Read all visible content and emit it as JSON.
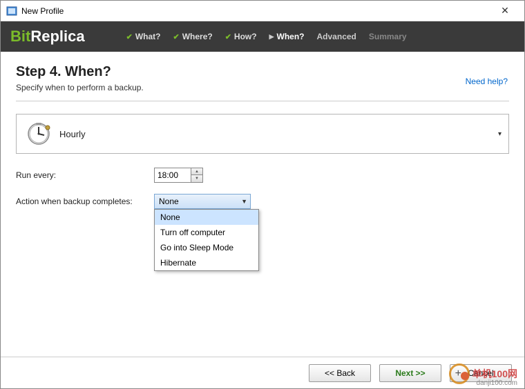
{
  "titlebar": {
    "title": "New Profile"
  },
  "logo": {
    "bit": "Bit",
    "replica": "Replica"
  },
  "nav": {
    "what": "What?",
    "where": "Where?",
    "how": "How?",
    "when": "When?",
    "advanced": "Advanced",
    "summary": "Summary"
  },
  "step": {
    "title": "Step 4. When?",
    "subtitle": "Specify when to perform a backup.",
    "help": "Need help?"
  },
  "schedule": {
    "label": "Hourly"
  },
  "form": {
    "run_every_label": "Run every:",
    "run_every_value": "18:00",
    "action_label": "Action when backup completes:",
    "action_selected": "None",
    "action_options": [
      "None",
      "Turn off computer",
      "Go into Sleep Mode",
      "Hibernate"
    ]
  },
  "footer": {
    "back": "<<  Back",
    "next": "Next  >>",
    "cancel": "Cancel"
  },
  "watermark": {
    "main": "单机100网",
    "sub": "danji100.com"
  }
}
